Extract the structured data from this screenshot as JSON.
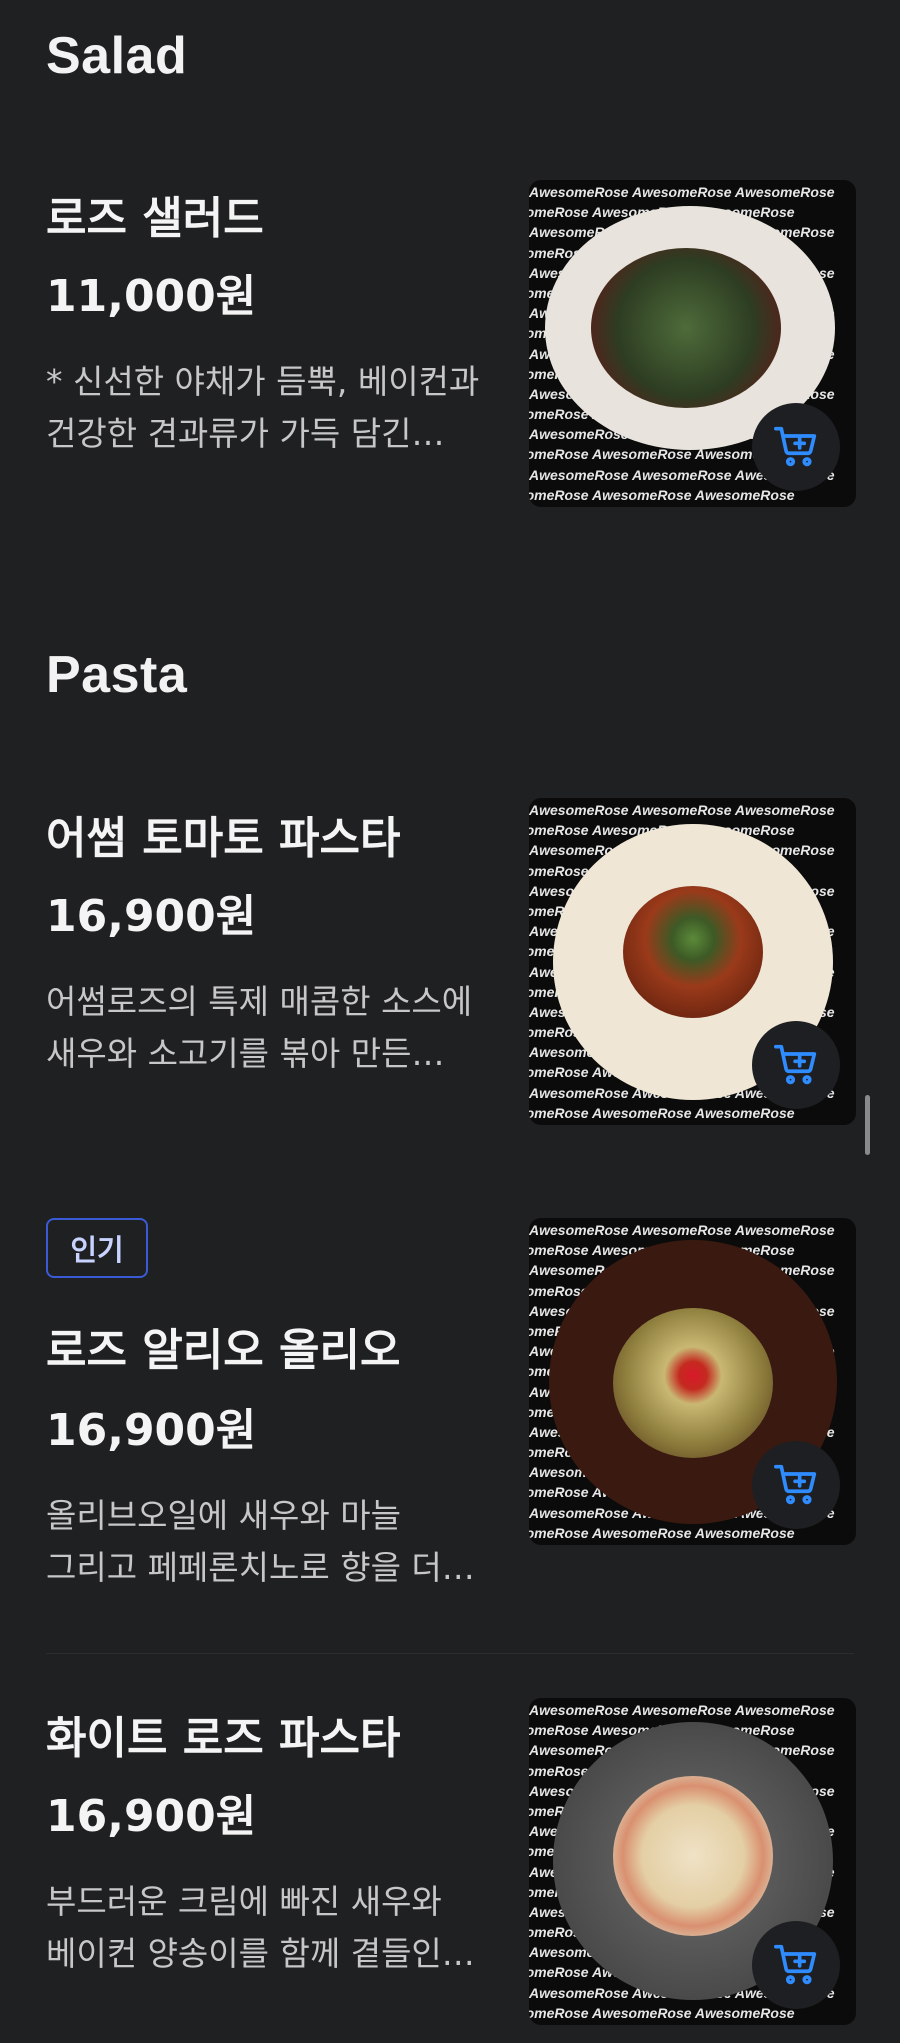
{
  "sections": [
    {
      "title": "Salad",
      "items": [
        {
          "name": "로즈 샐러드",
          "price": "11,000원",
          "description": "* 신선한 야채가 듬뿍, 베이컨과 건강한 견과류가 가득 담긴 샐러드",
          "badge": "",
          "watermark": "AwesomeRose AwesomeRose AwesomeRose"
        }
      ]
    },
    {
      "title": "Pasta",
      "items": [
        {
          "name": "어썸 토마토 파스타",
          "price": "16,900원",
          "description": "어썸로즈의 특제 매콤한 소스에 새우와 소고기를 볶아 만든 파스타",
          "badge": "",
          "watermark": "AwesomeRose AwesomeRose AwesomeRose"
        },
        {
          "name": "로즈 알리오 올리오",
          "price": "16,900원",
          "description": "올리브오일에 새우와 마늘 그리고 페페론치노로 향을 더한 파스타",
          "badge": "인기",
          "watermark": "AwesomeRose AwesomeRose AwesomeRose"
        },
        {
          "name": "화이트 로즈 파스타",
          "price": "16,900원",
          "description": "부드러운 크림에 빠진 새우와 베이컨 양송이를 함께 곁들인 파스타",
          "badge": "",
          "watermark": "AwesomeRose AwesomeRose AwesomeRose"
        }
      ]
    }
  ],
  "icons": {
    "cart": "add-to-cart-icon"
  },
  "colors": {
    "background": "#1f2022",
    "cart_icon": "#2f8cff",
    "badge_border": "#3b5bd6"
  }
}
